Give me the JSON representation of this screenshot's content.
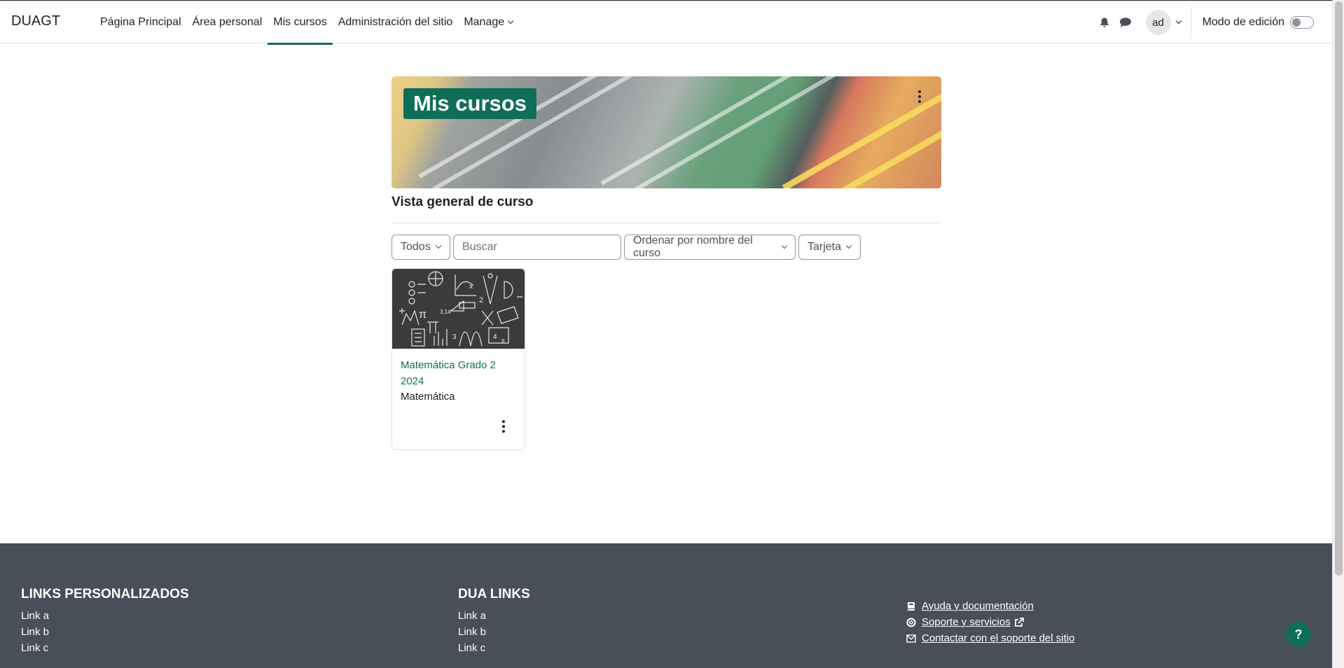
{
  "app": {
    "brand": "DUAGT"
  },
  "nav": {
    "items": [
      {
        "label": "Página Principal"
      },
      {
        "label": "Área personal"
      },
      {
        "label": "Mis cursos",
        "active": true
      },
      {
        "label": "Administración del sitio"
      },
      {
        "label": "Manage",
        "has_dropdown": true
      }
    ],
    "user_initials": "ad",
    "edit_mode_label": "Modo de edición",
    "edit_mode_on": false,
    "icons": [
      "bell-icon",
      "chat-icon"
    ]
  },
  "header": {
    "title": "Mis cursos"
  },
  "overview": {
    "title": "Vista general de curso",
    "filters": {
      "grouping": "Todos",
      "search_placeholder": "Buscar",
      "sort": "Ordenar por nombre del curso",
      "view": "Tarjeta"
    }
  },
  "courses": [
    {
      "name": "Matemática Grado 2 2024",
      "category": "Matemática"
    }
  ],
  "footer": {
    "col1": {
      "title": "LINKS PERSONALIZADOS",
      "links": [
        "Link a",
        "Link b",
        "Link c"
      ]
    },
    "col2": {
      "title": "DUA LINKS",
      "links": [
        "Link a",
        "Link b",
        "Link c"
      ]
    },
    "support": {
      "docs": "Ayuda y documentación",
      "services": "Soporte y servicios",
      "contact": "Contactar con el soporte del sitio"
    },
    "help_button": "?"
  },
  "colors": {
    "accent": "#0f6e5a",
    "footer_bg": "#484f58"
  }
}
